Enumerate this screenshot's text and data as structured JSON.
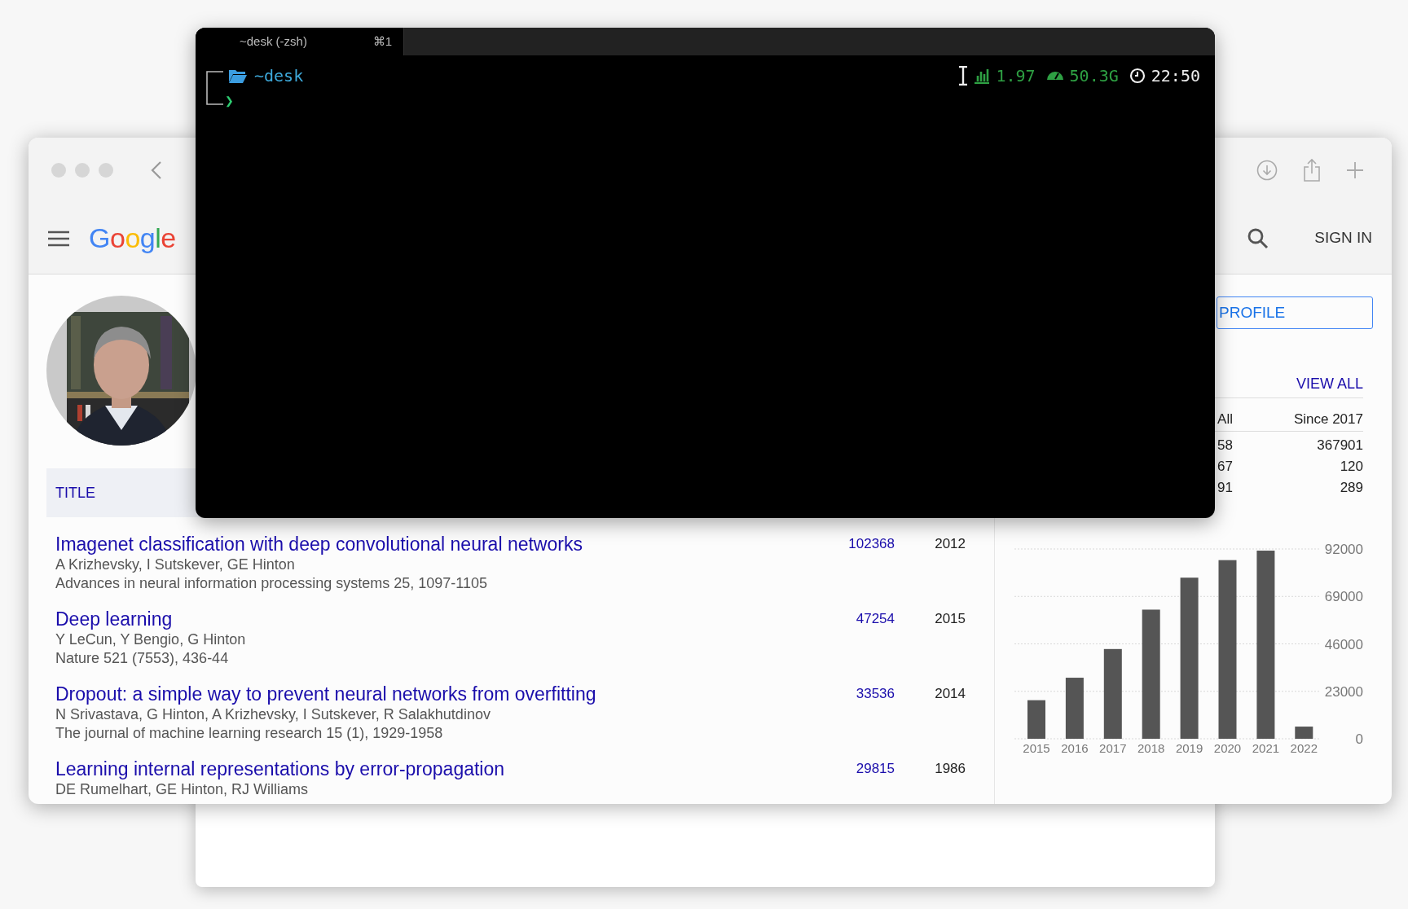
{
  "browser": {
    "header": {
      "logo": "Google",
      "sign_in": "SIGN IN"
    },
    "profile_button": "PROFILE",
    "articles": {
      "header": "TITLE",
      "items": [
        {
          "title": "Imagenet classification with deep convolutional neural networks",
          "authors": "A Krizhevsky, I Sutskever, GE Hinton",
          "venue": "Advances in neural information processing systems 25, 1097-1105",
          "cited": "102368",
          "year": "2012"
        },
        {
          "title": "Deep learning",
          "authors": "Y LeCun, Y Bengio, G Hinton",
          "venue": "Nature 521 (7553), 436-44",
          "cited": "47254",
          "year": "2015"
        },
        {
          "title": "Dropout: a simple way to prevent neural networks from overfitting",
          "authors": "N Srivastava, G Hinton, A Krizhevsky, I Sutskever, R Salakhutdinov",
          "venue": "The journal of machine learning research 15 (1), 1929-1958",
          "cited": "33536",
          "year": "2014"
        },
        {
          "title": "Learning internal representations by error-propagation",
          "authors": "DE Rumelhart, GE Hinton, RJ Williams",
          "cited": "29815",
          "year": "1986"
        }
      ]
    },
    "cited_by": {
      "view_all": "VIEW ALL",
      "columns": [
        "All",
        "Since 2017"
      ],
      "rows": [
        [
          "58",
          "367901"
        ],
        [
          "67",
          "120"
        ],
        [
          "91",
          "289"
        ]
      ]
    },
    "chart_data": {
      "type": "bar",
      "categories": [
        "2015",
        "2016",
        "2017",
        "2018",
        "2019",
        "2020",
        "2021",
        "2022"
      ],
      "series": [
        {
          "color": "#555555",
          "values": [
            18700,
            29600,
            43500,
            62600,
            78100,
            86600,
            91200,
            5900
          ]
        }
      ],
      "grid": true,
      "ylim": [
        0,
        92000
      ],
      "yticks": [
        0,
        23000,
        46000,
        69000,
        92000
      ]
    }
  },
  "terminal": {
    "tab": {
      "title": "~desk (-zsh)",
      "shortcut": "⌘1",
      "selected": true
    },
    "cwd": "~desk",
    "prompt": "❯",
    "load": "1.97",
    "memory": "50.3G",
    "time": "22:50"
  }
}
